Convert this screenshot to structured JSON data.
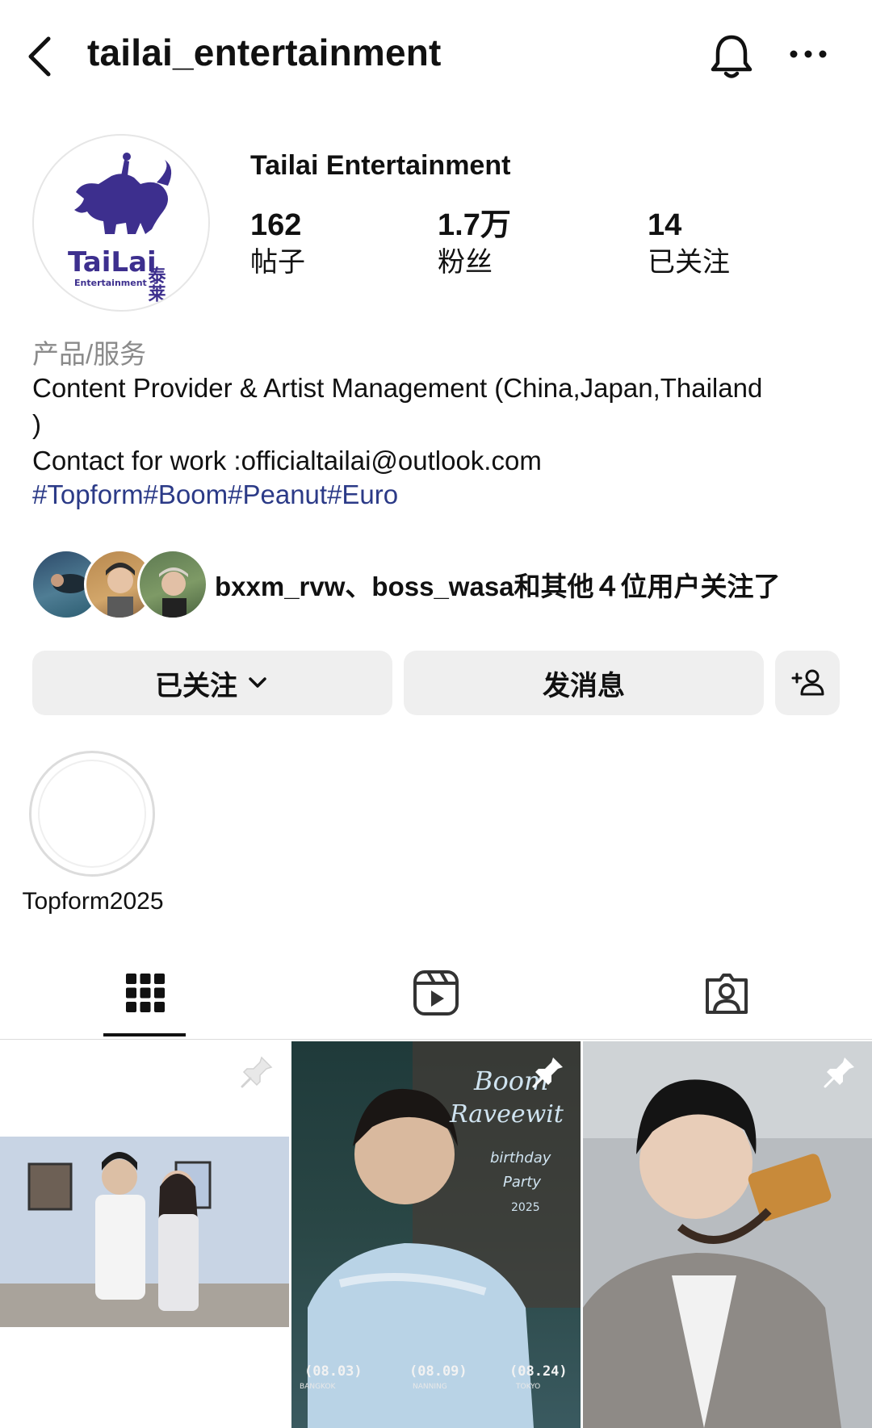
{
  "header": {
    "username": "tailai_entertainment",
    "back_icon": "chevron-left-icon",
    "bell_icon": "bell-icon",
    "more_icon": "more-horizontal-icon"
  },
  "profile": {
    "display_name": "Tailai Entertainment",
    "avatar_logo_text": "TaiLai",
    "avatar_logo_sub": "Entertainment",
    "avatar_logo_cn": "泰莱",
    "stats": [
      {
        "value": "162",
        "label": "帖子"
      },
      {
        "value": "1.7万",
        "label": "粉丝"
      },
      {
        "value": "14",
        "label": "已关注"
      }
    ]
  },
  "bio": {
    "category": "产品/服务",
    "line1": "Content Provider & Artist Management (China,Japan,Thailand",
    "line2": ")",
    "line3": "Contact for work :officialtailai@outlook.com",
    "hashtags": "#Topform#Boom#Peanut#Euro"
  },
  "mutual": {
    "text": "bxxm_rvw、boss_wasa和其他４位用户关注了"
  },
  "buttons": {
    "following": "已关注",
    "message": "发消息",
    "add_user_icon": "add-user-icon"
  },
  "highlights": [
    {
      "label": "Topform2025"
    }
  ],
  "tabs": [
    {
      "name": "posts-grid",
      "icon": "grid-icon",
      "active": true
    },
    {
      "name": "reels",
      "icon": "reels-icon",
      "active": false
    },
    {
      "name": "tagged",
      "icon": "tagged-user-icon",
      "active": false
    }
  ],
  "posts": [
    {
      "pinned": true
    },
    {
      "pinned": true,
      "overlay": {
        "title1": "Boom",
        "title2": "Raveewit",
        "note1": "birthday",
        "note2": "Party",
        "year": "2025",
        "dates": [
          {
            "date": "(08.03)",
            "city": "BANGKOK"
          },
          {
            "date": "(08.09)",
            "city": "NANNING"
          },
          {
            "date": "(08.24)",
            "city": "TOKYO"
          }
        ]
      }
    },
    {
      "pinned": true
    }
  ],
  "colors": {
    "brand_purple": "#3d2f8e",
    "hashtag_blue": "#2b3a87",
    "button_bg": "#efefef"
  }
}
